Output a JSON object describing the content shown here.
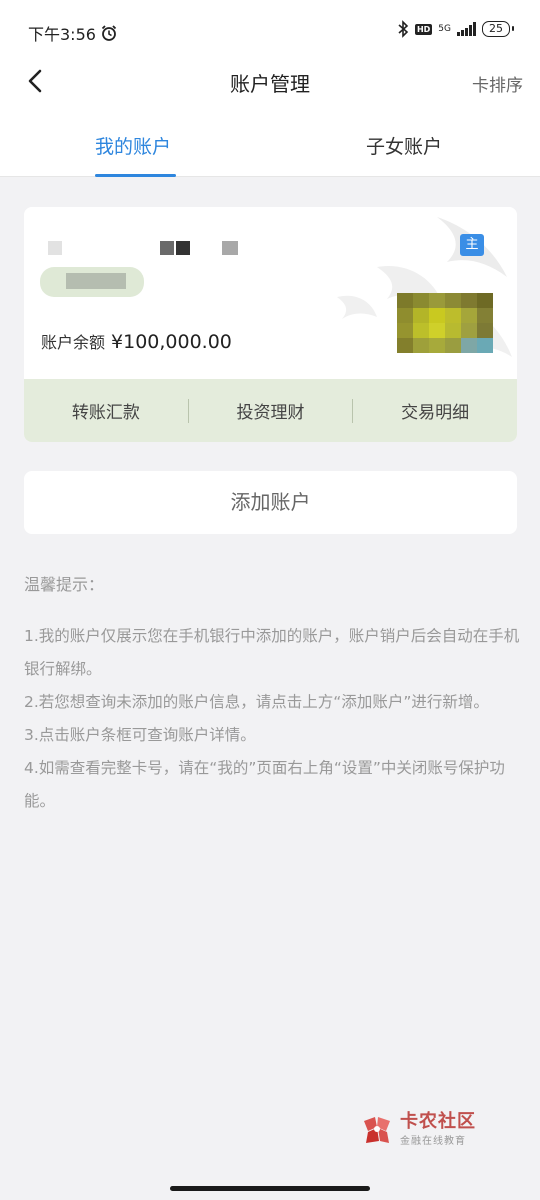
{
  "status_bar": {
    "time": "下午3:56",
    "hd_label": "HD",
    "network": "5G",
    "battery": "25"
  },
  "nav": {
    "title": "账户管理",
    "sort_label": "卡排序"
  },
  "tabs": [
    {
      "label": "我的账户",
      "active": true
    },
    {
      "label": "子女账户",
      "active": false
    }
  ],
  "account_card": {
    "badge": "主",
    "balance_label": "账户余额",
    "balance_value": "¥100,000.00",
    "actions": [
      "转账汇款",
      "投资理财",
      "交易明细"
    ]
  },
  "add_account_label": "添加账户",
  "tips": {
    "title": "温馨提示：",
    "items": [
      "1.我的账户仅展示您在手机银行中添加的账户，账户销户后会自动在手机银行解绑。",
      "2.若您想查询未添加的账户信息，请点击上方“添加账户”进行新增。",
      "3.点击账户条框可查询账户详情。",
      "4.如需查看完整卡号，请在“我的”页面右上角“设置”中关闭账号保护功能。"
    ]
  },
  "watermark": {
    "name": "卡农社区",
    "sub": "金融在线教育"
  },
  "colors": {
    "accent": "#2e86de",
    "card_actions_bg": "#e4ecdc",
    "badge": "#3a8ee6"
  }
}
